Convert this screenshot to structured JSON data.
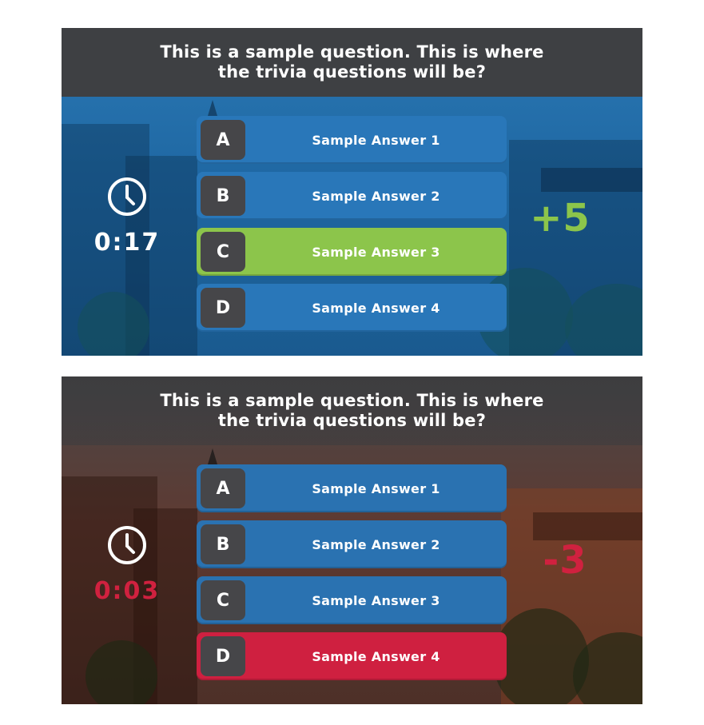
{
  "panels": [
    {
      "state": "correct",
      "question": "This is a sample question.  This is where the trivia questions will be?",
      "timer": "0:17",
      "score": "+5",
      "answers": [
        {
          "letter": "A",
          "label": "Sample Answer 1",
          "status": "default"
        },
        {
          "letter": "B",
          "label": "Sample Answer 2",
          "status": "default"
        },
        {
          "letter": "C",
          "label": "Sample Answer 3",
          "status": "correct"
        },
        {
          "letter": "D",
          "label": "Sample Answer 4",
          "status": "default"
        }
      ]
    },
    {
      "state": "wrong",
      "question": "This is a sample question.  This is where the trivia questions will be?",
      "timer": "0:03",
      "score": "-3",
      "answers": [
        {
          "letter": "A",
          "label": "Sample Answer 1",
          "status": "default"
        },
        {
          "letter": "B",
          "label": "Sample Answer 2",
          "status": "default"
        },
        {
          "letter": "C",
          "label": "Sample Answer 3",
          "status": "default"
        },
        {
          "letter": "D",
          "label": "Sample Answer 4",
          "status": "wrong"
        }
      ]
    }
  ],
  "colors": {
    "answer_default": "#2977b9",
    "answer_correct": "#8cc54b",
    "answer_wrong": "#cf2040",
    "letter_badge": "#464649",
    "header": "#3e4043"
  },
  "icons": {
    "timer": "clock-icon"
  }
}
